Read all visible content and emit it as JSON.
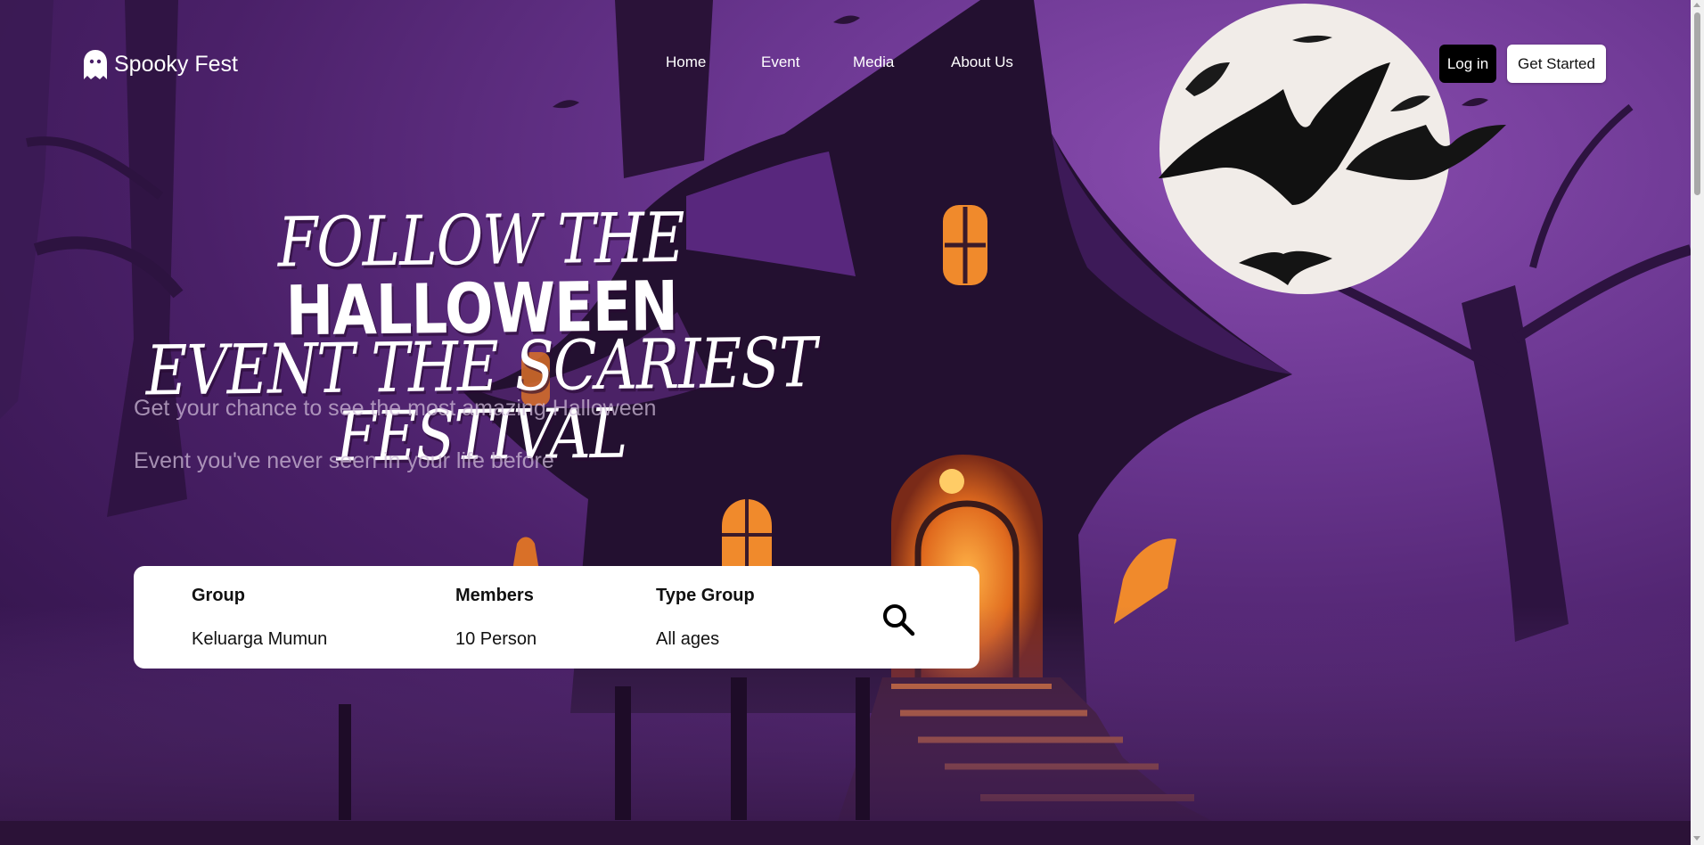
{
  "brand": {
    "name": "Spooky Fest",
    "logo_icon": "ghost-icon"
  },
  "nav": {
    "items": [
      {
        "label": "Home"
      },
      {
        "label": "Event"
      },
      {
        "label": "Media"
      },
      {
        "label": "About Us"
      }
    ]
  },
  "auth": {
    "login_label": "Log in",
    "get_started_label": "Get Started"
  },
  "hero": {
    "headline_line1_a": "FOLLOW THE ",
    "headline_line1_b": "HALLOWEEN",
    "headline_line2": "EVENT THE SCARIEST FESTIVAL",
    "subtitle_line1": "Get your chance to see the most amazing Halloween",
    "subtitle_line2": "Event you've never seen in your life before"
  },
  "search": {
    "fields": [
      {
        "label": "Group",
        "value": "Keluarga Mumun"
      },
      {
        "label": "Members",
        "value": "10 Person"
      },
      {
        "label": "Type Group",
        "value": "All ages"
      }
    ],
    "icon": "search-icon"
  },
  "colors": {
    "background_purple": "#6a3690",
    "window_glow": "#f08a2c",
    "moon": "#f1ece8",
    "card": "#ffffff",
    "login_button": "#000000"
  }
}
